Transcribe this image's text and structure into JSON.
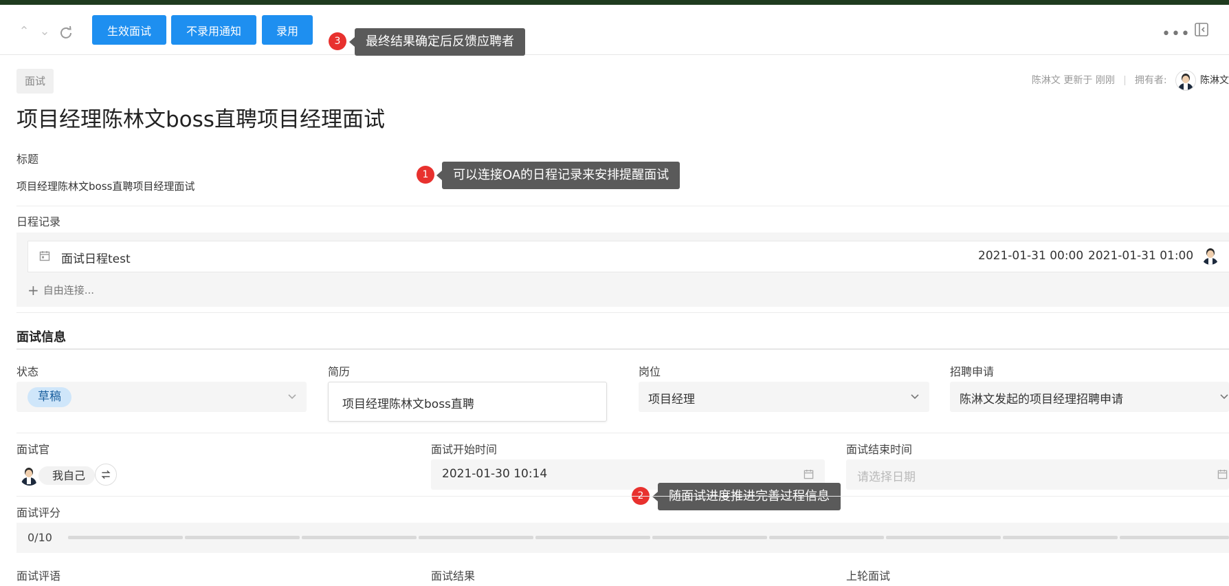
{
  "toolbar": {
    "buttons": {
      "activate": "生效面试",
      "reject_notice": "不录用通知",
      "hire": "录用"
    }
  },
  "annotations": [
    {
      "num": "1",
      "text": "可以连接OA的日程记录来安排提醒面试"
    },
    {
      "num": "2",
      "text": "随面试进度推进完善过程信息"
    },
    {
      "num": "3",
      "text": "最终结果确定后反馈应聘者"
    }
  ],
  "header": {
    "tag": "面试",
    "updated": "陈淋文 更新于 刚刚",
    "owner_label": "拥有者:",
    "owner_name": "陈淋文",
    "title": "项目经理陈林文boss直聘项目经理面试"
  },
  "fields": {
    "title_label": "标题",
    "title_value": "项目经理陈林文boss直聘项目经理面试",
    "schedule_label": "日程记录",
    "schedule": {
      "name": "面试日程test",
      "start": "2021-01-31 00:00",
      "end": "2021-01-31 01:00",
      "add_link": "自由连接..."
    }
  },
  "section": {
    "title": "面试信息",
    "status_label": "状态",
    "status_value": "草稿",
    "resume_label": "简历",
    "resume_value": "项目经理陈林文boss直聘",
    "position_label": "岗位",
    "position_value": "项目经理",
    "request_label": "招聘申请",
    "request_value": "陈淋文发起的项目经理招聘申请",
    "interviewer_label": "面试官",
    "interviewer_value": "我自己",
    "start_label": "面试开始时间",
    "start_value": "2021-01-30 10:14",
    "end_label": "面试结束时间",
    "end_placeholder": "请选择日期",
    "rating_label": "面试评分",
    "rating_value": "0/10",
    "rating_score": 0,
    "rating_max": 10,
    "comment_label": "面试评语",
    "result_label": "面试结果",
    "prev_label": "上轮面试"
  },
  "colors": {
    "primary": "#1e8ff0",
    "annotation_dot": "#e8312e",
    "annotation_box": "#5a5a5a",
    "status_pill": "#cfe6fa"
  }
}
